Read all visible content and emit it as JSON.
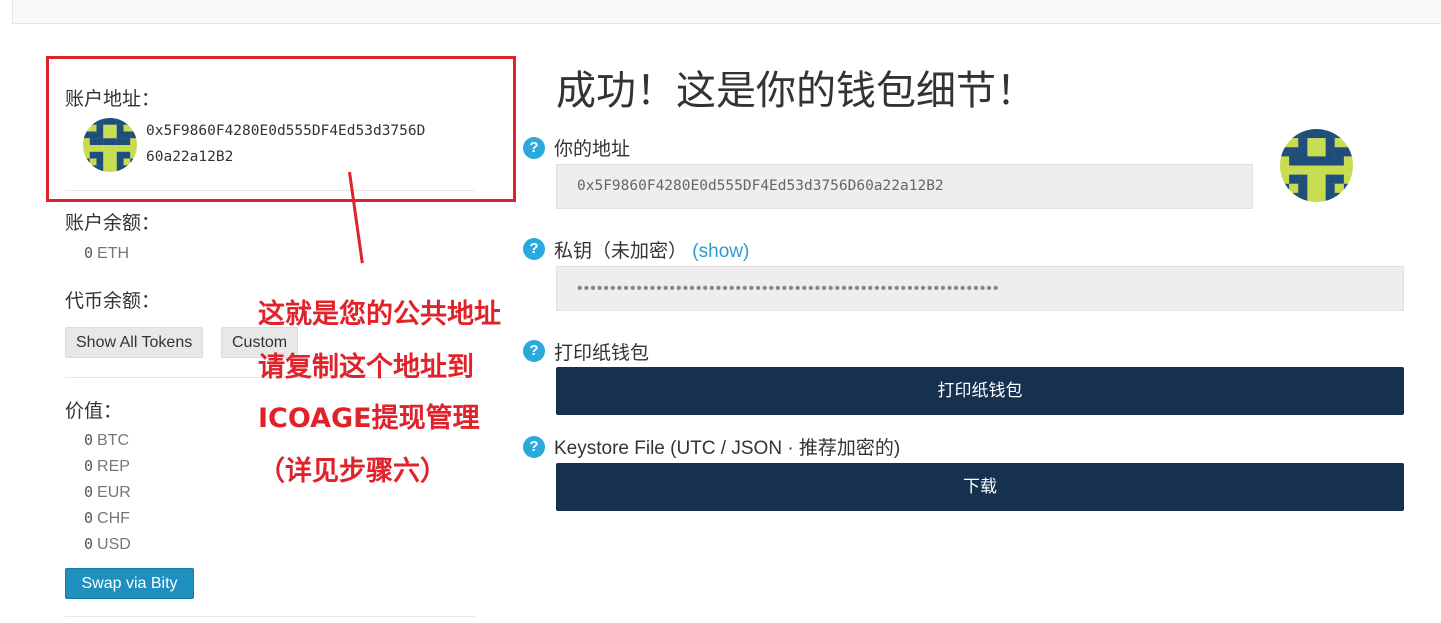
{
  "sidebar": {
    "account_address_label": "账户地址：",
    "address_line1": "0x5F9860F4280E0d555DF4Ed53d3756D",
    "address_line2": "60a22a12B2",
    "account_balance_label": "账户余额：",
    "eth_balance": {
      "value": "0",
      "unit": "ETH"
    },
    "token_balance_label": "代币余额：",
    "show_all_tokens": "Show All Tokens",
    "custom": "Custom",
    "value_label": "价值：",
    "values": [
      {
        "value": "0",
        "unit": "BTC"
      },
      {
        "value": "0",
        "unit": "REP"
      },
      {
        "value": "0",
        "unit": "EUR"
      },
      {
        "value": "0",
        "unit": "CHF"
      },
      {
        "value": "0",
        "unit": "USD"
      }
    ],
    "swap_button": "Swap via Bity"
  },
  "annotation": {
    "line1": "这就是您的公共地址",
    "line2": "请复制这个地址到",
    "line3": "ICOAGE提现管理",
    "line4": "（详见步骤六）",
    "color": "#e0232b"
  },
  "main": {
    "title": "成功！这是你的钱包细节！",
    "help_icon": "?",
    "your_address_label": "你的地址",
    "your_address_value": "0x5F9860F4280E0d555DF4Ed53d3756D60a22a12B2",
    "private_key_label": "私钥（未加密）",
    "show_link": "(show)",
    "private_key_masked": "••••••••••••••••••••••••••••••••••••••••••••••••••••••••••••••••",
    "print_label": "打印纸钱包",
    "print_button": "打印纸钱包",
    "keystore_label": "Keystore File (UTC / JSON · 推荐加密的)",
    "download_button": "下载"
  },
  "colors": {
    "dark_button": "#16304f",
    "help_icon": "#29a9dc",
    "swap_button": "#1f8fc0",
    "identicon_green": "#c8dc52",
    "identicon_navy": "#1e4e79"
  },
  "icons": {
    "identicon": "identicon-avatar",
    "help": "question-circle-icon"
  }
}
